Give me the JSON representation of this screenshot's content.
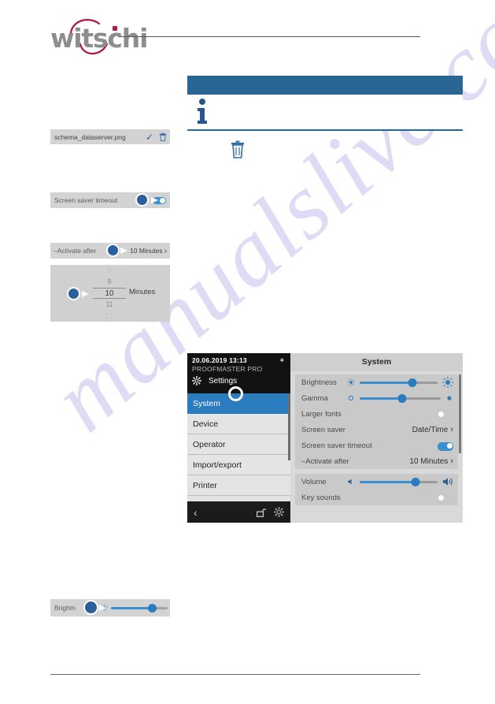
{
  "watermark": {
    "text": "manualslive.com"
  },
  "brand": {
    "wordmark": "witschi"
  },
  "note_box": {
    "header_text": "",
    "info_icon": "info-icon",
    "body_text": "",
    "trash_icon": "trash-icon"
  },
  "fragments": {
    "file_row": {
      "filename": "schema_dataserver.png",
      "check_icon": "✓",
      "trash_icon": "trash-icon"
    },
    "screen_saver_timeout": {
      "label": "Screen saver timeout",
      "toggle_state": "on",
      "touch_indicator": "touch-dot"
    },
    "activate_after": {
      "label": "–Activate after",
      "value": "10 Minutes",
      "chevron": "›",
      "touch_indicator": "touch-dot"
    },
    "picker": {
      "items": [
        "8",
        "9",
        "10",
        "11",
        "12"
      ],
      "selected_index": 2,
      "unit": "Minutes",
      "touch_indicator": "touch-dot"
    },
    "brightness": {
      "label": "Brightn",
      "low_icon": "brightness-low-icon",
      "high_icon": "brightness-high-icon",
      "value_percent": 62,
      "touch_indicator": "touch-dot"
    }
  },
  "device": {
    "status_bar": {
      "datetime": "20.06.2019 13:13",
      "bluetooth_icon": "✶",
      "model": "PROOFMASTER PRO"
    },
    "screen_title": "Settings",
    "gear_icon": "gear-icon",
    "menu": [
      {
        "label": "System",
        "active": true
      },
      {
        "label": "Device",
        "active": false
      },
      {
        "label": "Operator",
        "active": false
      },
      {
        "label": "Import/export",
        "active": false
      },
      {
        "label": "Printer",
        "active": false
      }
    ],
    "nav_bar": {
      "back_icon": "‹",
      "lock_icon": "unlock-icon",
      "gear_icon": "gear-icon"
    },
    "panel_title": "System",
    "card_display": [
      {
        "name": "brightness",
        "label": "Brightness",
        "type": "slider",
        "value_percent": 68
      },
      {
        "name": "gamma",
        "label": "Gamma",
        "type": "slider",
        "value_percent": 52
      },
      {
        "name": "larger-fonts",
        "label": "Larger fonts",
        "type": "toggle",
        "state": "off"
      },
      {
        "name": "screen-saver",
        "label": "Screen saver",
        "type": "value",
        "value": "Date/Time",
        "chevron": "›"
      },
      {
        "name": "screen-saver-timeout",
        "label": "Screen saver timeout",
        "type": "toggle",
        "state": "on"
      },
      {
        "name": "activate-after",
        "label": "–Activate after",
        "type": "value",
        "value": "10 Minutes",
        "chevron": "›"
      }
    ],
    "card_sound": [
      {
        "name": "volume",
        "label": "Volume",
        "type": "slider",
        "value_percent": 72
      },
      {
        "name": "key-sounds",
        "label": "Key sounds",
        "type": "toggle",
        "state": "off"
      }
    ]
  },
  "colors": {
    "brand_red": "#b4154b",
    "brand_gray": "#8d8d8d",
    "note_blue": "#2a6694",
    "accent_blue": "#2b7bbf",
    "toggle_on": "#3a8fd0",
    "touch_dot": "#2a5f9e"
  }
}
